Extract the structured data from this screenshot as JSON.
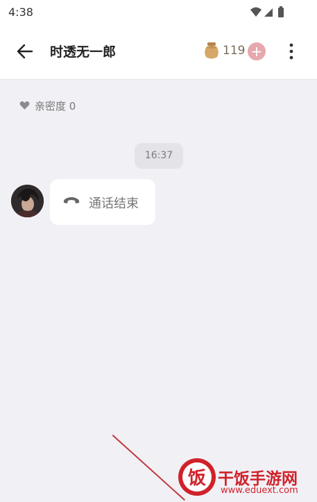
{
  "status_bar": {
    "time": "4:38"
  },
  "header": {
    "title": "时透无一郎",
    "coin_count": "119",
    "plus_symbol": "+",
    "icons": [
      "back-arrow-icon",
      "coin-pot-icon",
      "plus-icon",
      "more-vertical-icon"
    ]
  },
  "chat": {
    "intimacy_label": "亲密度 0",
    "timestamp": "16:37",
    "messages": [
      {
        "sender": "other",
        "icon": "phone-hangup-icon",
        "text": "通话结束"
      }
    ]
  },
  "watermark": {
    "logo_char": "饭",
    "name": "干饭手游网",
    "url": "www.eduext.com"
  },
  "colors": {
    "background": "#f1f0f5",
    "header_bg": "#ffffff",
    "plus_button": "#e6a8ad",
    "watermark_red": "#d0222b"
  }
}
